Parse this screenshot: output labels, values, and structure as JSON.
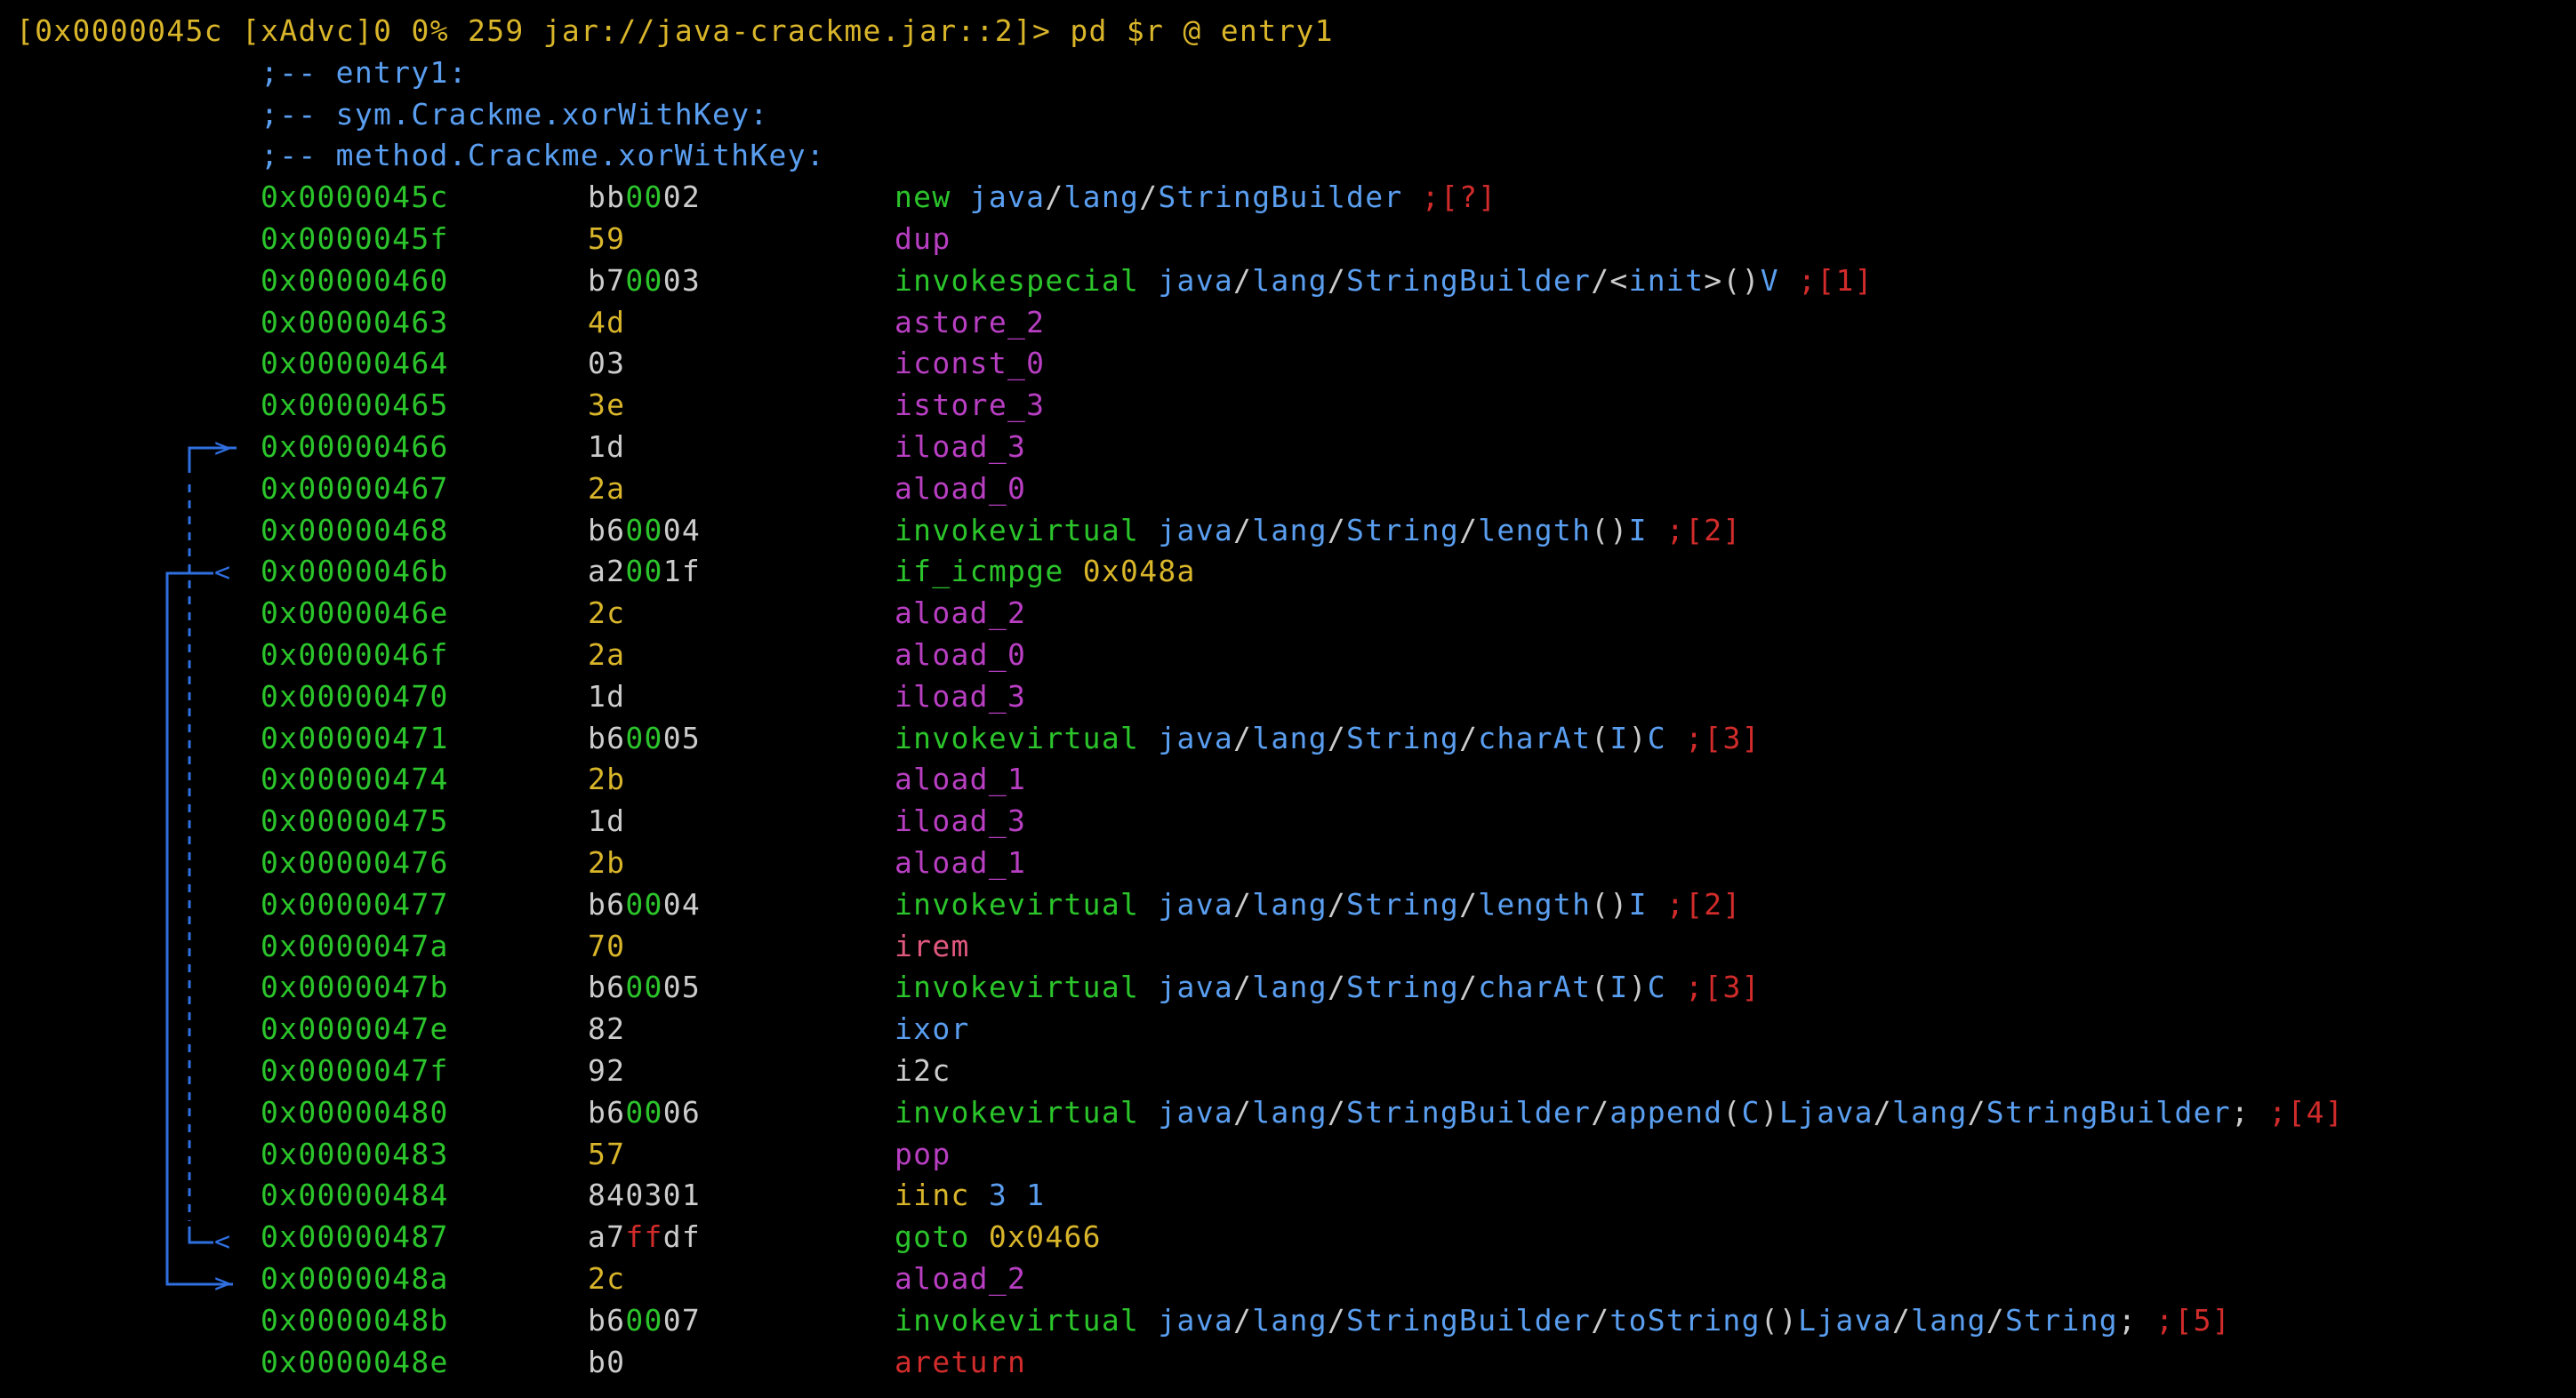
{
  "prompt": {
    "text": "[0x0000045c [xAdvc]0 0% 259 jar://java-crackme.jar::2]> pd $r @ entry1"
  },
  "flags": [
    ";-- entry1:",
    ";-- sym.Crackme.xorWithKey:",
    ";-- method.Crackme.xorWithKey:"
  ],
  "rows": [
    {
      "addr": "0x0000045c",
      "bytes": [
        [
          "bb",
          "white"
        ],
        [
          "00",
          "green"
        ],
        [
          "02",
          "white"
        ]
      ],
      "instr": [
        [
          "new ",
          "green"
        ],
        [
          "java",
          "blue"
        ],
        [
          "/",
          "white"
        ],
        [
          "lang",
          "blue"
        ],
        [
          "/",
          "white"
        ],
        [
          "StringBuilder",
          "blue"
        ],
        [
          " ;[?]",
          "red"
        ]
      ]
    },
    {
      "addr": "0x0000045f",
      "bytes": [
        [
          "59",
          "yellow"
        ]
      ],
      "instr": [
        [
          "dup",
          "magenta"
        ]
      ]
    },
    {
      "addr": "0x00000460",
      "bytes": [
        [
          "b7",
          "white"
        ],
        [
          "00",
          "green"
        ],
        [
          "03",
          "white"
        ]
      ],
      "instr": [
        [
          "invokespecial ",
          "green"
        ],
        [
          "java",
          "blue"
        ],
        [
          "/",
          "white"
        ],
        [
          "lang",
          "blue"
        ],
        [
          "/",
          "white"
        ],
        [
          "StringBuilder",
          "blue"
        ],
        [
          "/",
          "white"
        ],
        [
          "<",
          "white"
        ],
        [
          "init",
          "blue"
        ],
        [
          ">",
          "white"
        ],
        [
          "(",
          "white"
        ],
        [
          ")",
          "white"
        ],
        [
          "V",
          "blue"
        ],
        [
          " ;[1]",
          "red"
        ]
      ]
    },
    {
      "addr": "0x00000463",
      "bytes": [
        [
          "4d",
          "yellow"
        ]
      ],
      "instr": [
        [
          "astore_2",
          "magenta"
        ]
      ]
    },
    {
      "addr": "0x00000464",
      "bytes": [
        [
          "03",
          "white"
        ]
      ],
      "instr": [
        [
          "iconst_0",
          "magenta"
        ]
      ]
    },
    {
      "addr": "0x00000465",
      "bytes": [
        [
          "3e",
          "yellow"
        ]
      ],
      "instr": [
        [
          "istore_3",
          "magenta"
        ]
      ]
    },
    {
      "addr": "0x00000466",
      "bytes": [
        [
          "1d",
          "white"
        ]
      ],
      "instr": [
        [
          "iload_3",
          "magenta"
        ]
      ]
    },
    {
      "addr": "0x00000467",
      "bytes": [
        [
          "2a",
          "yellow"
        ]
      ],
      "instr": [
        [
          "aload_0",
          "magenta"
        ]
      ]
    },
    {
      "addr": "0x00000468",
      "bytes": [
        [
          "b6",
          "white"
        ],
        [
          "00",
          "green"
        ],
        [
          "04",
          "white"
        ]
      ],
      "instr": [
        [
          "invokevirtual ",
          "green"
        ],
        [
          "java",
          "blue"
        ],
        [
          "/",
          "white"
        ],
        [
          "lang",
          "blue"
        ],
        [
          "/",
          "white"
        ],
        [
          "String",
          "blue"
        ],
        [
          "/",
          "white"
        ],
        [
          "length",
          "blue"
        ],
        [
          "(",
          "white"
        ],
        [
          ")",
          "white"
        ],
        [
          "I",
          "blue"
        ],
        [
          " ;[2]",
          "red"
        ]
      ]
    },
    {
      "addr": "0x0000046b",
      "bytes": [
        [
          "a2",
          "white"
        ],
        [
          "00",
          "green"
        ],
        [
          "1f",
          "white"
        ]
      ],
      "instr": [
        [
          "if_icmpge ",
          "green"
        ],
        [
          "0x048a",
          "yellow"
        ]
      ]
    },
    {
      "addr": "0x0000046e",
      "bytes": [
        [
          "2c",
          "yellow"
        ]
      ],
      "instr": [
        [
          "aload_2",
          "magenta"
        ]
      ]
    },
    {
      "addr": "0x0000046f",
      "bytes": [
        [
          "2a",
          "yellow"
        ]
      ],
      "instr": [
        [
          "aload_0",
          "magenta"
        ]
      ]
    },
    {
      "addr": "0x00000470",
      "bytes": [
        [
          "1d",
          "white"
        ]
      ],
      "instr": [
        [
          "iload_3",
          "magenta"
        ]
      ]
    },
    {
      "addr": "0x00000471",
      "bytes": [
        [
          "b6",
          "white"
        ],
        [
          "00",
          "green"
        ],
        [
          "05",
          "white"
        ]
      ],
      "instr": [
        [
          "invokevirtual ",
          "green"
        ],
        [
          "java",
          "blue"
        ],
        [
          "/",
          "white"
        ],
        [
          "lang",
          "blue"
        ],
        [
          "/",
          "white"
        ],
        [
          "String",
          "blue"
        ],
        [
          "/",
          "white"
        ],
        [
          "charAt",
          "blue"
        ],
        [
          "(",
          "white"
        ],
        [
          "I",
          "blue"
        ],
        [
          ")",
          "white"
        ],
        [
          "C",
          "blue"
        ],
        [
          " ;[3]",
          "red"
        ]
      ]
    },
    {
      "addr": "0x00000474",
      "bytes": [
        [
          "2b",
          "yellow"
        ]
      ],
      "instr": [
        [
          "aload_1",
          "magenta"
        ]
      ]
    },
    {
      "addr": "0x00000475",
      "bytes": [
        [
          "1d",
          "white"
        ]
      ],
      "instr": [
        [
          "iload_3",
          "magenta"
        ]
      ]
    },
    {
      "addr": "0x00000476",
      "bytes": [
        [
          "2b",
          "yellow"
        ]
      ],
      "instr": [
        [
          "aload_1",
          "magenta"
        ]
      ]
    },
    {
      "addr": "0x00000477",
      "bytes": [
        [
          "b6",
          "white"
        ],
        [
          "00",
          "green"
        ],
        [
          "04",
          "white"
        ]
      ],
      "instr": [
        [
          "invokevirtual ",
          "green"
        ],
        [
          "java",
          "blue"
        ],
        [
          "/",
          "white"
        ],
        [
          "lang",
          "blue"
        ],
        [
          "/",
          "white"
        ],
        [
          "String",
          "blue"
        ],
        [
          "/",
          "white"
        ],
        [
          "length",
          "blue"
        ],
        [
          "(",
          "white"
        ],
        [
          ")",
          "white"
        ],
        [
          "I",
          "blue"
        ],
        [
          " ;[2]",
          "red"
        ]
      ]
    },
    {
      "addr": "0x0000047a",
      "bytes": [
        [
          "70",
          "yellow"
        ]
      ],
      "instr": [
        [
          "irem",
          "pink"
        ]
      ]
    },
    {
      "addr": "0x0000047b",
      "bytes": [
        [
          "b6",
          "white"
        ],
        [
          "00",
          "green"
        ],
        [
          "05",
          "white"
        ]
      ],
      "instr": [
        [
          "invokevirtual ",
          "green"
        ],
        [
          "java",
          "blue"
        ],
        [
          "/",
          "white"
        ],
        [
          "lang",
          "blue"
        ],
        [
          "/",
          "white"
        ],
        [
          "String",
          "blue"
        ],
        [
          "/",
          "white"
        ],
        [
          "charAt",
          "blue"
        ],
        [
          "(",
          "white"
        ],
        [
          "I",
          "blue"
        ],
        [
          ")",
          "white"
        ],
        [
          "C",
          "blue"
        ],
        [
          " ;[3]",
          "red"
        ]
      ]
    },
    {
      "addr": "0x0000047e",
      "bytes": [
        [
          "82",
          "white"
        ]
      ],
      "instr": [
        [
          "ixor",
          "blue"
        ]
      ]
    },
    {
      "addr": "0x0000047f",
      "bytes": [
        [
          "92",
          "white"
        ]
      ],
      "instr": [
        [
          "i2c",
          "white"
        ]
      ]
    },
    {
      "addr": "0x00000480",
      "bytes": [
        [
          "b6",
          "white"
        ],
        [
          "00",
          "green"
        ],
        [
          "06",
          "white"
        ]
      ],
      "instr": [
        [
          "invokevirtual ",
          "green"
        ],
        [
          "java",
          "blue"
        ],
        [
          "/",
          "white"
        ],
        [
          "lang",
          "blue"
        ],
        [
          "/",
          "white"
        ],
        [
          "StringBuilder",
          "blue"
        ],
        [
          "/",
          "white"
        ],
        [
          "append",
          "blue"
        ],
        [
          "(",
          "white"
        ],
        [
          "C",
          "blue"
        ],
        [
          ")",
          "white"
        ],
        [
          "Ljava",
          "blue"
        ],
        [
          "/",
          "white"
        ],
        [
          "lang",
          "blue"
        ],
        [
          "/",
          "white"
        ],
        [
          "StringBuilder",
          "blue"
        ],
        [
          ";",
          "white"
        ],
        [
          " ;[4]",
          "red"
        ]
      ]
    },
    {
      "addr": "0x00000483",
      "bytes": [
        [
          "57",
          "yellow"
        ]
      ],
      "instr": [
        [
          "pop",
          "magenta"
        ]
      ]
    },
    {
      "addr": "0x00000484",
      "bytes": [
        [
          "840301",
          "white"
        ]
      ],
      "instr": [
        [
          "iinc ",
          "yellow"
        ],
        [
          "3 1",
          "blue"
        ]
      ]
    },
    {
      "addr": "0x00000487",
      "bytes": [
        [
          "a7",
          "white"
        ],
        [
          "ff",
          "red"
        ],
        [
          "df",
          "white"
        ]
      ],
      "instr": [
        [
          "goto ",
          "green"
        ],
        [
          "0x0466",
          "yellow"
        ]
      ]
    },
    {
      "addr": "0x0000048a",
      "bytes": [
        [
          "2c",
          "yellow"
        ]
      ],
      "instr": [
        [
          "aload_2",
          "magenta"
        ]
      ]
    },
    {
      "addr": "0x0000048b",
      "bytes": [
        [
          "b6",
          "white"
        ],
        [
          "00",
          "green"
        ],
        [
          "07",
          "white"
        ]
      ],
      "instr": [
        [
          "invokevirtual ",
          "green"
        ],
        [
          "java",
          "blue"
        ],
        [
          "/",
          "white"
        ],
        [
          "lang",
          "blue"
        ],
        [
          "/",
          "white"
        ],
        [
          "StringBuilder",
          "blue"
        ],
        [
          "/",
          "white"
        ],
        [
          "toString",
          "blue"
        ],
        [
          "(",
          "white"
        ],
        [
          ")",
          "white"
        ],
        [
          "Ljava",
          "blue"
        ],
        [
          "/",
          "white"
        ],
        [
          "lang",
          "blue"
        ],
        [
          "/",
          "white"
        ],
        [
          "String",
          "blue"
        ],
        [
          ";",
          "white"
        ],
        [
          " ;[5]",
          "red"
        ]
      ]
    },
    {
      "addr": "0x0000048e",
      "bytes": [
        [
          "b0",
          "white"
        ]
      ],
      "instr": [
        [
          "areturn",
          "red"
        ]
      ]
    }
  ],
  "colors": {
    "background": "#000000",
    "yellow": "#d9b52a",
    "green": "#2bc42b",
    "blue": "#5a9ef0",
    "white": "#cccccc",
    "magenta": "#b83ec2",
    "red": "#d12b2b",
    "pink": "#e0587d",
    "arrow": "#2f6fe0"
  },
  "flow_arrows": [
    {
      "name": "loop-back-arrow",
      "from": "0x00000487",
      "to": "0x00000466"
    },
    {
      "name": "loop-exit-arrow",
      "from": "0x0000046b",
      "to": "0x0000048a"
    }
  ]
}
